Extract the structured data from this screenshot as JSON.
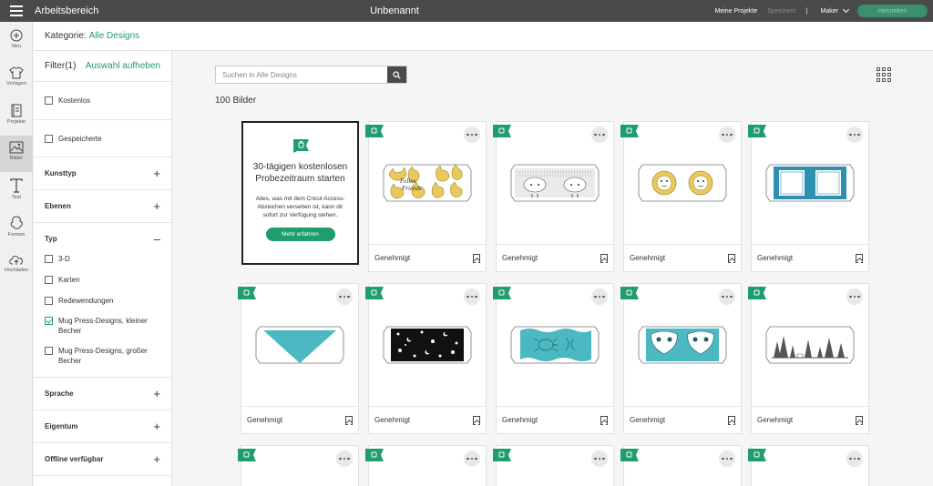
{
  "topbar": {
    "app_title": "Arbeitsbereich",
    "doc_title": "Unbenannt",
    "my_projects": "Meine Projekte",
    "save": "Speichern",
    "separator": "|",
    "machine": "Maker",
    "make_button": "Herstellen"
  },
  "rail": {
    "items": [
      {
        "label": "Neu",
        "icon": "plus-circle-icon"
      },
      {
        "label": "Vorlagen",
        "icon": "shirt-icon"
      },
      {
        "label": "Projekte",
        "icon": "projects-icon"
      },
      {
        "label": "Bilder",
        "icon": "image-icon"
      },
      {
        "label": "Text",
        "icon": "text-icon"
      },
      {
        "label": "Formen",
        "icon": "shapes-icon"
      },
      {
        "label": "Hochladen",
        "icon": "upload-cloud-icon"
      }
    ],
    "active_index": 3
  },
  "category": {
    "label": "Kategorie:",
    "value": "Alle Designs"
  },
  "filters": {
    "title": "Filter(1)",
    "clear": "Auswahl aufheben",
    "free": "Kostenlos",
    "saved": "Gespeicherte",
    "sections_top": [
      "Kunsttyp",
      "Ebenen"
    ],
    "typ": {
      "title": "Typ",
      "items": [
        {
          "label": "3-D",
          "checked": false
        },
        {
          "label": "Karten",
          "checked": false
        },
        {
          "label": "Redewendungen",
          "checked": false
        },
        {
          "label": "Mug Press-Designs, kleiner Becher",
          "checked": true
        },
        {
          "label": "Mug Press-Designs, großer Becher",
          "checked": false
        }
      ]
    },
    "sections_bottom": [
      "Sprache",
      "Eigentum",
      "Offline verfügbar"
    ],
    "plus": "+",
    "minus": "–"
  },
  "main": {
    "search_placeholder": "Suchen in Alle Designs",
    "count": "100 Bilder",
    "promo": {
      "title": "30-tägigen kostenlosen Probezeitraum starten",
      "body": "Alles, was mit dem Cricut Access-Abzeichen versehen ist, kann dir sofort zur Verfügung stehen.",
      "button": "Mehr erfahren"
    },
    "card_label": "Genehmigt"
  },
  "colors": {
    "accent": "#1f9d6e",
    "topbar": "#4a4a4a",
    "teal": "#2e9cb0",
    "yellow": "#e9c95a"
  }
}
